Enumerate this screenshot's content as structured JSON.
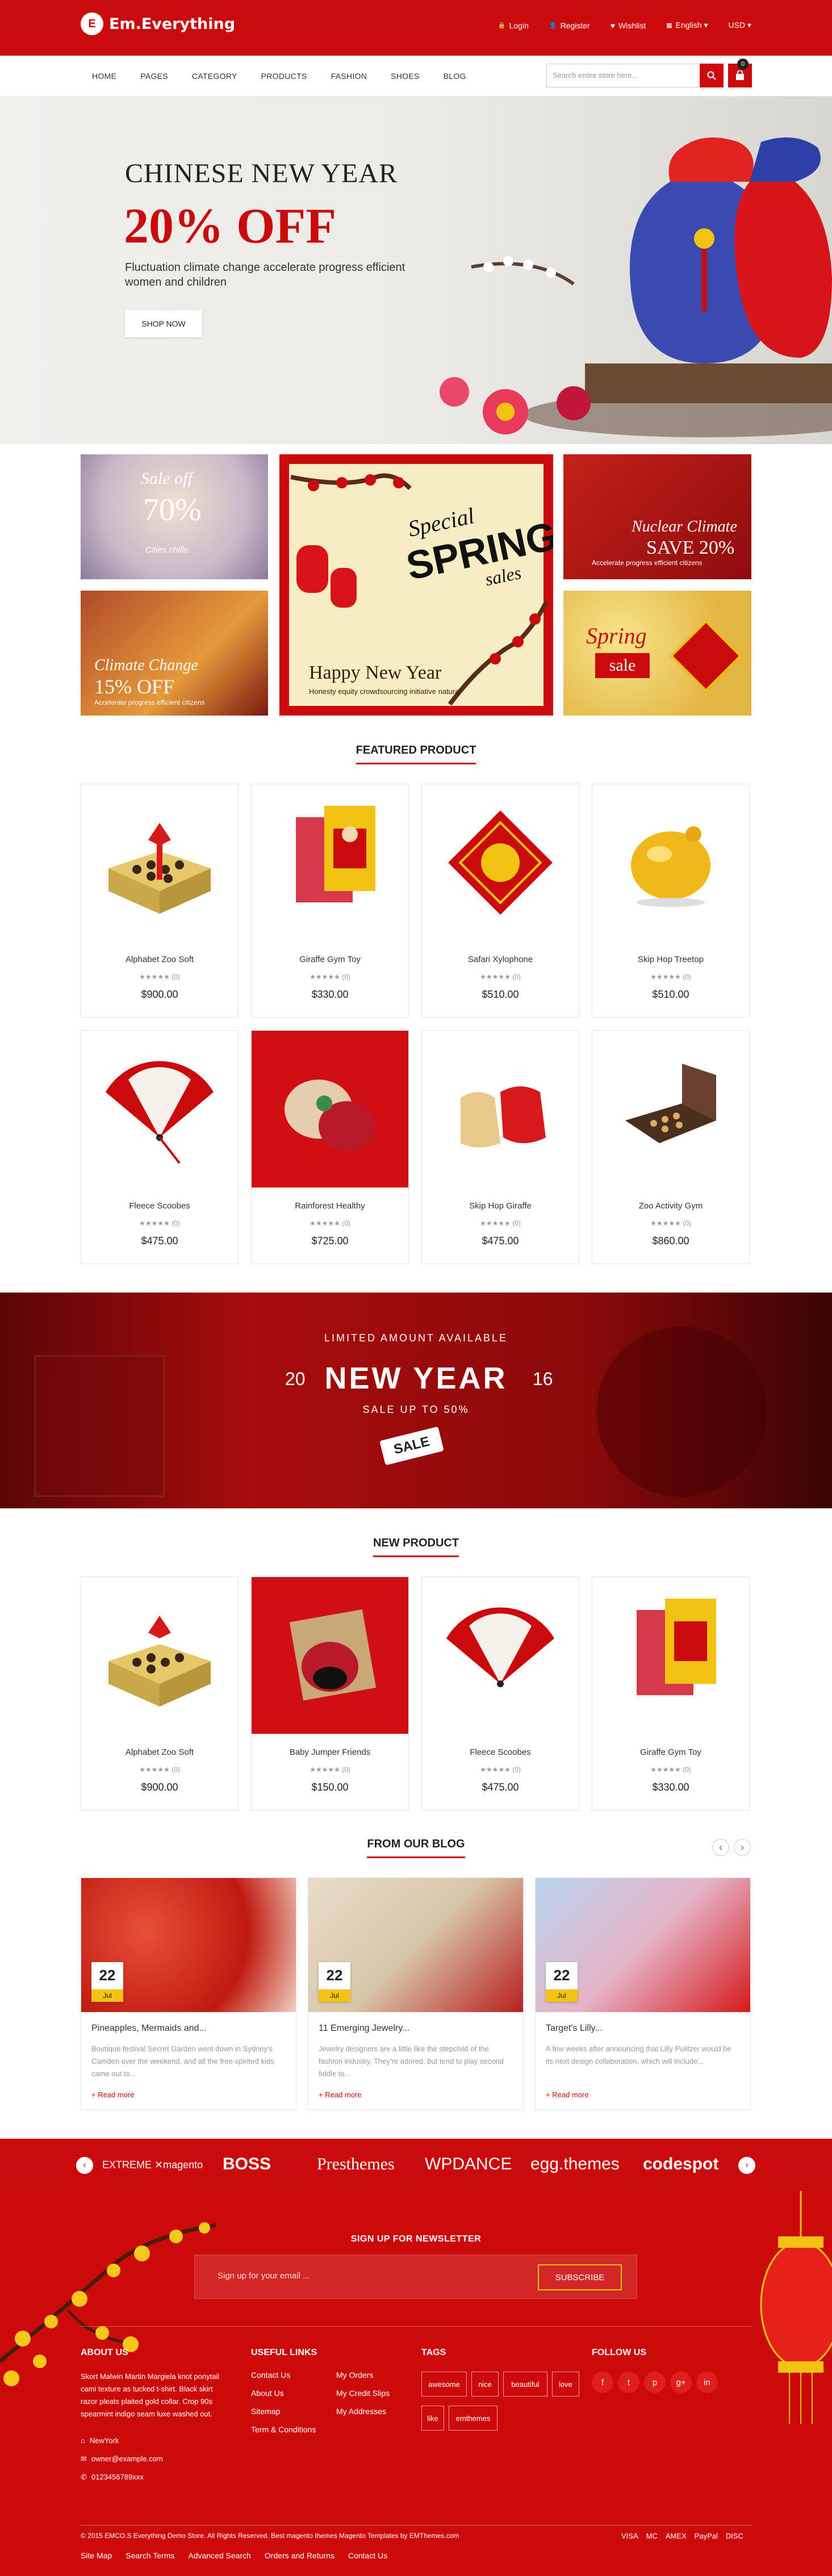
{
  "header": {
    "logo_mark": "E",
    "logo_text": "Em.Everything",
    "links": [
      {
        "icon": "lock-icon",
        "glyph": "🔒",
        "label": "Login"
      },
      {
        "icon": "user-icon",
        "glyph": "👤",
        "label": "Register"
      },
      {
        "icon": "heart-icon",
        "glyph": "♥",
        "label": "Wishlist"
      },
      {
        "icon": "flag-icon",
        "glyph": "▦",
        "label": "English ▾"
      },
      {
        "icon": "currency-icon",
        "glyph": "",
        "label": "USD ▾"
      }
    ]
  },
  "nav": {
    "items": [
      "HOME",
      "PAGES",
      "CATEGORY",
      "PRODUCTS",
      "FASHION",
      "SHOES",
      "BLOG"
    ],
    "search_placeholder": "Search entire store here...",
    "cart_count": "0"
  },
  "hero": {
    "title": "CHINESE NEW YEAR",
    "offer": "20% OFF",
    "subtitle": "Fluctuation climate change accelerate progress efficient women and children",
    "button": "SHOP NOW"
  },
  "banners": {
    "b1": {
      "line1": "Sale off",
      "line2": "70%",
      "line3": "Cities chille"
    },
    "b2": {
      "line1": "Special",
      "line2": "SPRING",
      "line3": "sales",
      "line4": "Happy New Year",
      "line5": "Honesty equity crowdsourcing initiative natural"
    },
    "b3": {
      "line1": "Nuclear Climate",
      "line2": "SAVE 20%",
      "line3": "Accelerate progress efficient citizens"
    },
    "b4": {
      "line1": "Climate Change",
      "line2": "15% OFF",
      "line3": "Accelerate progress efficient citizens"
    },
    "b5": {
      "line1": "Spring",
      "line2": "sale"
    }
  },
  "featured": {
    "title": "FEATURED PRODUCT",
    "products": [
      {
        "name": "Alphabet Zoo Soft",
        "rating": "★★★★★ (0)",
        "price": "$900.00"
      },
      {
        "name": "Giraffe Gym Toy",
        "rating": "★★★★★ (0)",
        "price": "$330.00"
      },
      {
        "name": "Safari Xylophone",
        "rating": "★★★★★ (0)",
        "price": "$510.00"
      },
      {
        "name": "Skip Hop Treetop",
        "rating": "★★★★★ (0)",
        "price": "$510.00"
      },
      {
        "name": "Fleece Scoobes",
        "rating": "★★★★★ (0)",
        "price": "$475.00"
      },
      {
        "name": "Rainforest Healthy",
        "rating": "★★★★★ (0)",
        "price": "$725.00"
      },
      {
        "name": "Skip Hop Giraffe",
        "rating": "★★★★★ (0)",
        "price": "$475.00"
      },
      {
        "name": "Zoo Activity Gym",
        "rating": "★★★★★ (0)",
        "price": "$860.00"
      }
    ]
  },
  "promo": {
    "top": "LIMITED AMOUNT AVAILABLE",
    "year_left": "20",
    "main": "NEW YEAR",
    "year_right": "16",
    "sub": "SALE UP TO 50%",
    "tag": "SALE"
  },
  "new_products": {
    "title": "NEW PRODUCT",
    "products": [
      {
        "name": "Alphabet Zoo Soft",
        "rating": "★★★★★ (0)",
        "price": "$900.00"
      },
      {
        "name": "Baby Jumper Friends",
        "rating": "★★★★★ (0)",
        "price": "$150.00"
      },
      {
        "name": "Fleece Scoobes",
        "rating": "★★★★★ (0)",
        "price": "$475.00"
      },
      {
        "name": "Giraffe Gym Toy",
        "rating": "★★★★★ (0)",
        "price": "$330.00"
      }
    ]
  },
  "blog": {
    "title": "FROM OUR BLOG",
    "prev": "‹",
    "next": "›",
    "posts": [
      {
        "day": "22",
        "month": "Jul",
        "title": "Pineapples, Mermaids and...",
        "text": "Boutique festival Secret Garden went down in Sydney's Camden over the weekend, and all the free-spirited kids came out to...",
        "more": "+ Read more"
      },
      {
        "day": "22",
        "month": "Jul",
        "title": "11 Emerging Jewelry...",
        "text": "Jewelry designers are a little like the stepchild of the fashion industry. They're adored, but tend to play second fiddle to...",
        "more": "+ Read more"
      },
      {
        "day": "22",
        "month": "Jul",
        "title": "Target's Lilly...",
        "text": "A few weeks after announcing that Lilly Pulitzer would be its next design collaboration, which will include...",
        "more": "+ Read more"
      }
    ]
  },
  "brands": {
    "prev": "‹",
    "next": "›",
    "items": [
      "EXTREME ✕magento",
      "BOSS",
      "Presthemes",
      "WPDANCE",
      "egg.themes",
      "codespot"
    ]
  },
  "newsletter": {
    "title": "SIGN UP FOR NEWSLETTER",
    "placeholder": "Sign up for your email ...",
    "button": "SUBSCRIBE"
  },
  "footer": {
    "about_title": "ABOUT US",
    "about_text": "Skort Malwin Martin Margiela knot ponytail cami texture as tucked t-shirt. Black skirt razor pleats plaited gold collar. Crop 90s spearmint indigo seam luxe washed out.",
    "address": "NewYork",
    "email": "owner@example.com",
    "phone": "0123456789xxx",
    "links_title": "USEFUL LINKS",
    "links_col1": [
      "Contact Us",
      "About Us",
      "Sitemap",
      "Term & Conditions"
    ],
    "links_col2": [
      "My Orders",
      "My Credit Slips",
      "My Addresses"
    ],
    "tags_title": "TAGS",
    "tags": [
      "awesome",
      "nice",
      "beautiful",
      "love",
      "like",
      "emthemes"
    ],
    "follow_title": "FOLLOW US",
    "social": [
      {
        "icon": "facebook-icon",
        "glyph": "f"
      },
      {
        "icon": "twitter-icon",
        "glyph": "t"
      },
      {
        "icon": "pinterest-icon",
        "glyph": "p"
      },
      {
        "icon": "googleplus-icon",
        "glyph": "g+"
      },
      {
        "icon": "linkedin-icon",
        "glyph": "in"
      }
    ],
    "copyright": "© 2015 EMCO.S Everything Demo Store. All Rights Reserved. Best magento themes Magento Templates by EMThemes.com",
    "payments": [
      "VISA",
      "MC",
      "AMEX",
      "PayPal",
      "DISC"
    ],
    "bottom_links": [
      "Site Map",
      "Search Terms",
      "Advanced Search",
      "Orders and Returns",
      "Contact Us"
    ]
  },
  "colors": {
    "brand": "#cb0b0b",
    "accent": "#f2c312"
  }
}
